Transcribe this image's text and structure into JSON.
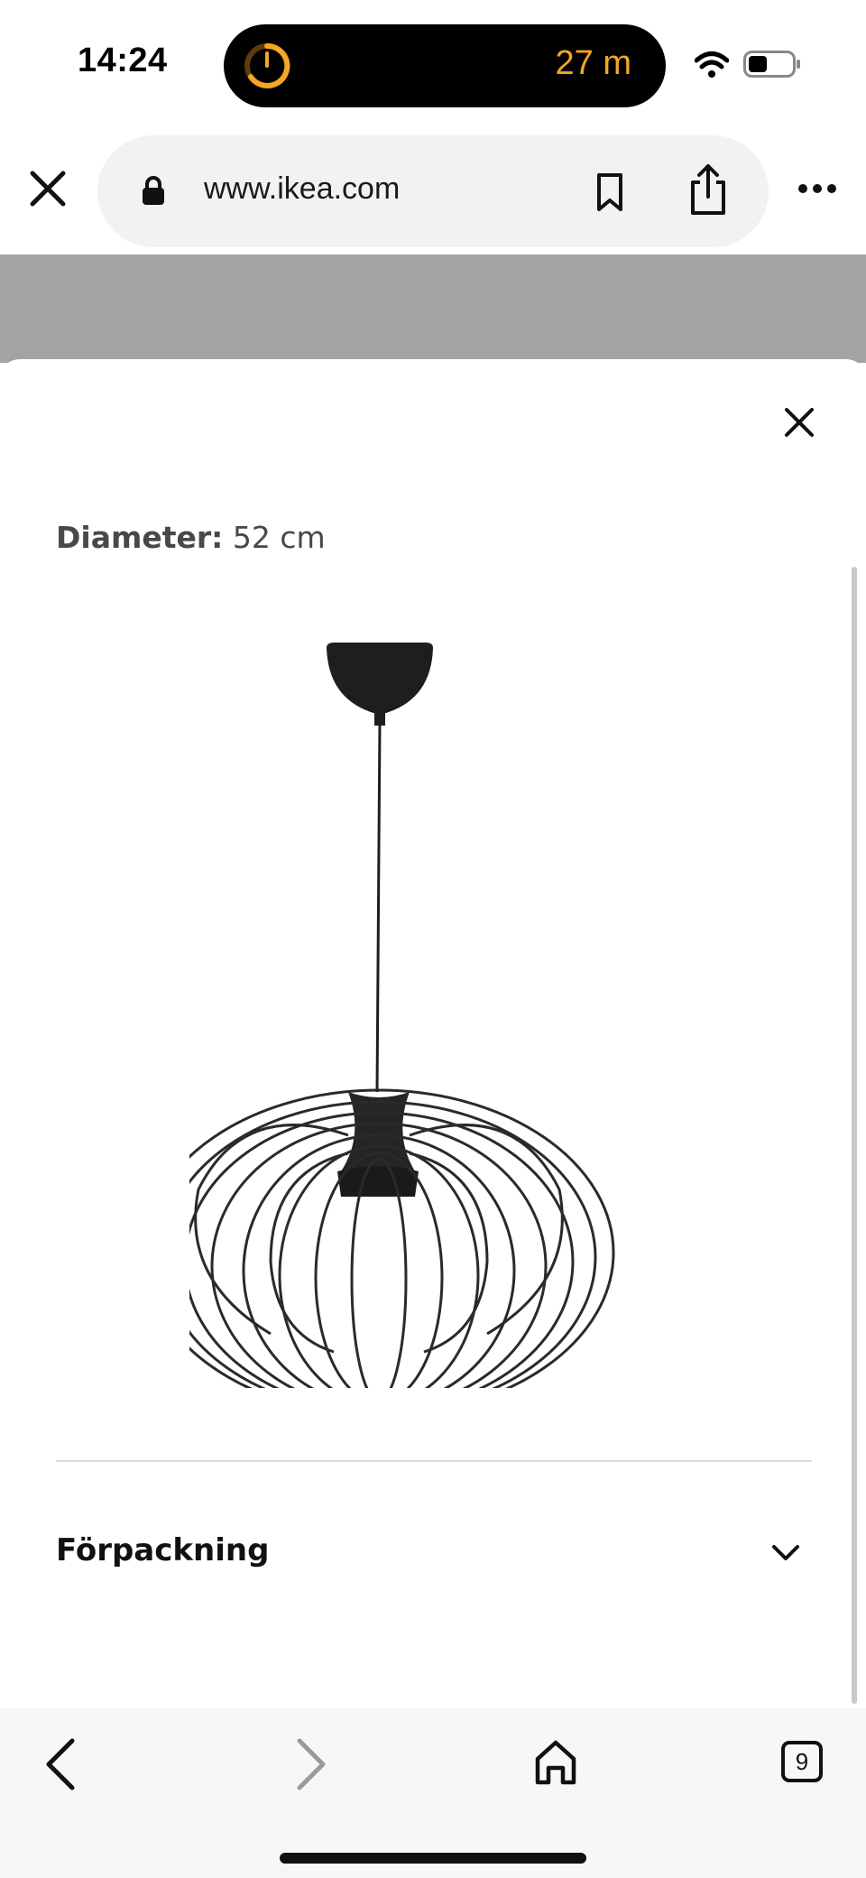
{
  "status_bar": {
    "time": "14:24",
    "timer_label": "27 m",
    "accent_color": "#f5a623"
  },
  "browser": {
    "url": "www.ikea.com",
    "icons": [
      "close-icon",
      "lock-icon",
      "bookmark-icon",
      "share-icon",
      "more-icon"
    ]
  },
  "sheet": {
    "diameter_label": "Diameter:",
    "diameter_value": "52 cm",
    "section_title": "Förpackning",
    "icons": [
      "close-icon",
      "chevron-down-icon"
    ]
  },
  "bottom_bar": {
    "tab_count": "9",
    "icons": [
      "back-icon",
      "forward-icon",
      "home-icon",
      "tabs-icon"
    ]
  }
}
